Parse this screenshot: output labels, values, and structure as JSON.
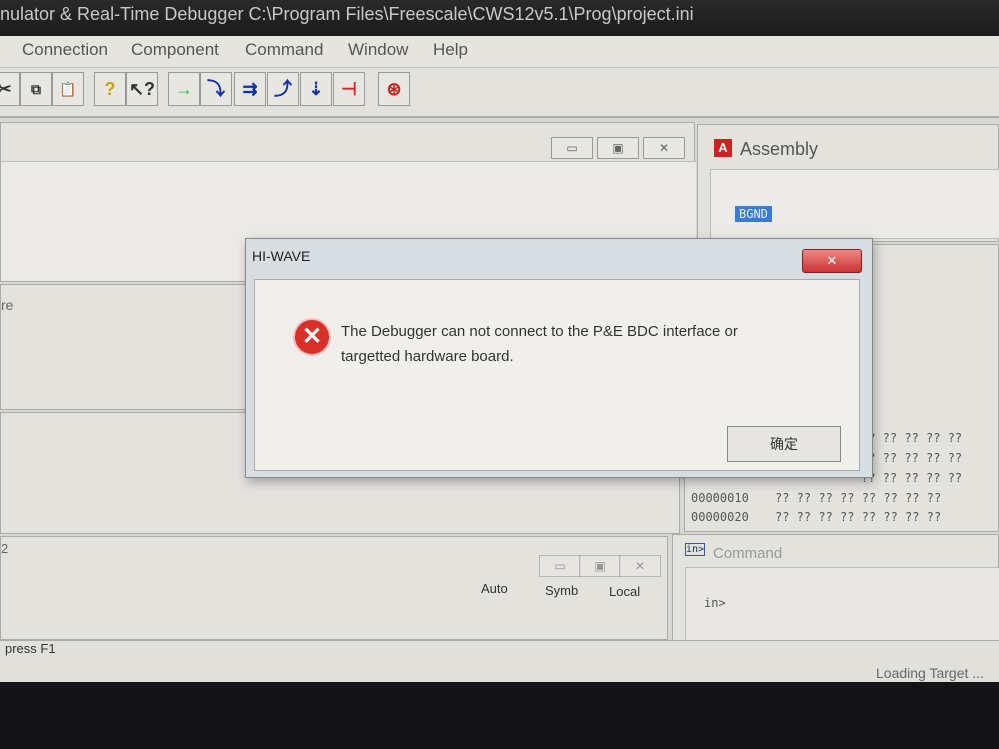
{
  "window": {
    "title": "nulator & Real-Time Debugger   C:\\Program Files\\Freescale\\CWS12v5.1\\Prog\\project.ini"
  },
  "menu": [
    "Connection",
    "Component",
    "Command",
    "Window",
    "Help"
  ],
  "toolbar": {
    "icons": [
      "cut-icon",
      "copy-icon",
      "paste-icon",
      "help-icon",
      "context-help-icon",
      "start-icon",
      "single-step-icon",
      "step-over-icon",
      "step-out-icon",
      "assembly-step-icon",
      "halt-icon",
      "reset-icon"
    ]
  },
  "left": {
    "partial_label": "re",
    "panel2_label": "2",
    "buttons": [
      "Auto",
      "Symb",
      "Local"
    ]
  },
  "assembly": {
    "title": "Assembly",
    "line": "BGND"
  },
  "memory": {
    "rows": [
      {
        "addr": "",
        "vals": "?? ?? ?? ?? ??"
      },
      {
        "addr": "",
        "vals": "?? ?? ?? ?? ??"
      },
      {
        "addr": "",
        "vals": "?? ?? ?? ?? ??"
      },
      {
        "addr": "00000010",
        "vals": "?? ?? ?? ?? ?? ?? ?? ??"
      },
      {
        "addr": "00000020",
        "vals": "?? ?? ?? ?? ?? ?? ?? ??"
      }
    ]
  },
  "command": {
    "title": "Command",
    "prompt": "in>"
  },
  "status": {
    "left": "press F1",
    "right": "Loading Target ..."
  },
  "dialog": {
    "title": "HI-WAVE",
    "message_line1": "The Debugger can not connect to the P&E BDC interface or",
    "message_line2": "targetted hardware board.",
    "ok_label": "确定",
    "close_glyph": "✕"
  },
  "colors": {
    "error": "#d9302a",
    "selection": "#3a7bd5"
  }
}
